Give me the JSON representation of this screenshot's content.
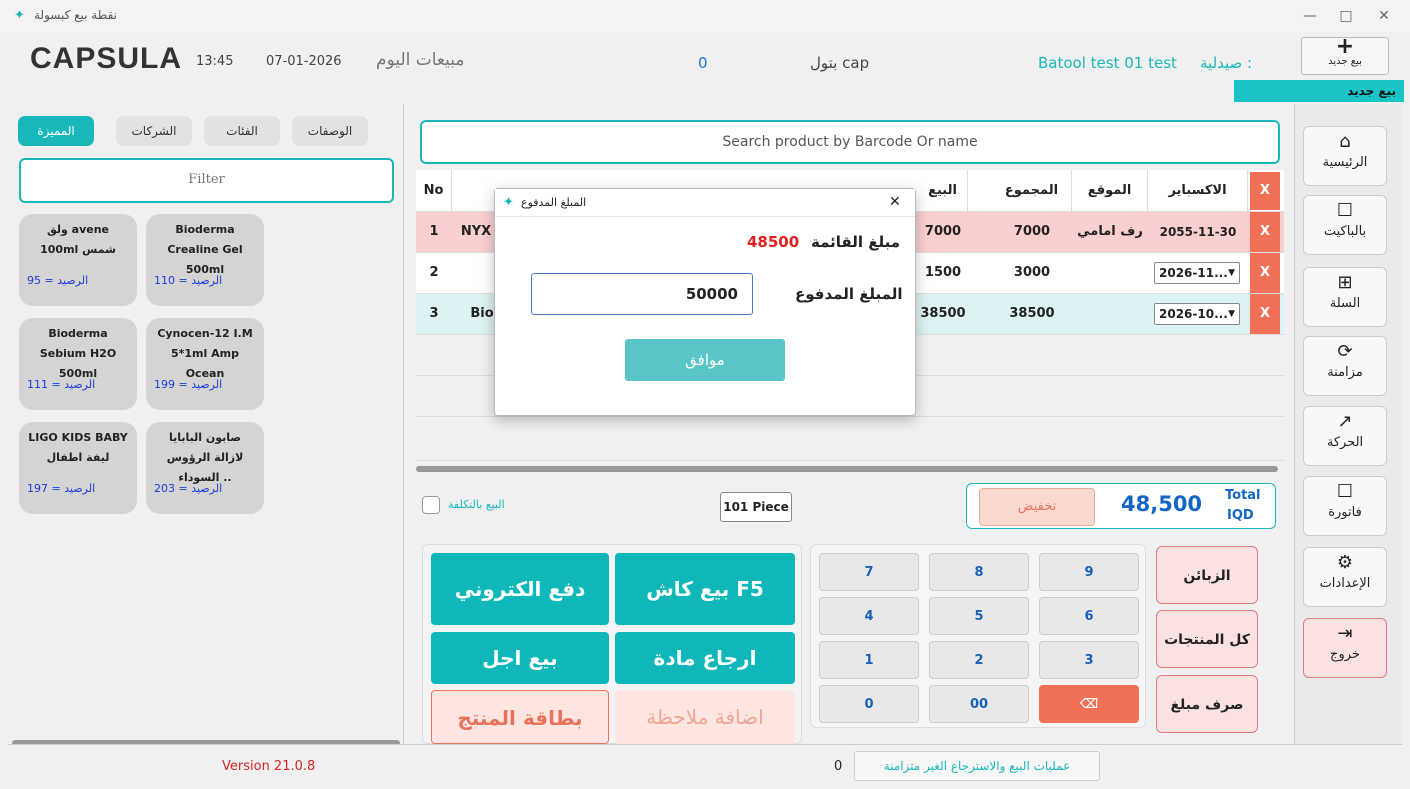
{
  "window": {
    "title": "نقطة بيع كبسولة",
    "min": "—",
    "max": "□",
    "close": "✕"
  },
  "header": {
    "logo": "CAPSULA",
    "time": "13:45",
    "date": "07-01-2026",
    "today_sales": "مبيعات اليوم",
    "today_value": "0",
    "user": "بتول cap",
    "pharmacy_label": "صيدلية :",
    "pharmacy_name": "Batool test 01 test",
    "new_sale": "بيع جديد",
    "new_sale_tag": "بيع جديد"
  },
  "left": {
    "tabs": [
      "الوصفات",
      "الفئات",
      "الشركات",
      "المميزة"
    ],
    "filter_placeholder": "Filter",
    "products": [
      {
        "name": "ولق avene 100ml شمس",
        "balance": "الرصيد = 95"
      },
      {
        "name": "Bioderma Crealine Gel 500ml",
        "balance": "الرصيد = 110"
      },
      {
        "name": "Bioderma Sebium H2O 500ml",
        "balance": "الرصيد = 111"
      },
      {
        "name": "Cynocen-12 I.M 5*1ml Amp Ocean",
        "balance": "الرصيد = 199"
      },
      {
        "name": "LIGO KIDS BABY ليفة اطفال",
        "balance": "الرصيد = 197"
      },
      {
        "name": "صابون البابايا لازالة الرؤوس السوداء ..",
        "balance": "الرصيد = 203"
      }
    ]
  },
  "main": {
    "search_placeholder": "Search product by Barcode Or  name",
    "columns": {
      "no": "No",
      "sale": "البيع",
      "total": "المجموع",
      "location": "الموقع",
      "expiry": "الاكسباير",
      "x": "X"
    },
    "rows": [
      {
        "no": "1",
        "name": "NYX",
        "sale": "7000",
        "total": "7000",
        "location": "رف امامي",
        "expiry": "2055-11-30",
        "x": "X"
      },
      {
        "no": "2",
        "name": "",
        "sale": "1500",
        "total": "3000",
        "location": "",
        "expiry": "2026-11...",
        "x": "X"
      },
      {
        "no": "3",
        "name": "Bio",
        "sale": "38500",
        "total": "38500",
        "location": "",
        "expiry": "2026-10...",
        "x": "X"
      }
    ],
    "sell_at_cost": "البيع بالتكلفة",
    "pieces": "101 Piece",
    "discount": "تخفيض",
    "total_value": "48,500",
    "total_label": "Total",
    "currency": "IQD",
    "actions": {
      "cash": "بيع كاش F5",
      "electronic": "دفع الكتروني",
      "return": "ارجاع مادة",
      "credit": "بيع اجل",
      "note": "اضافة ملاحظة",
      "card": "بطاقة المنتج"
    },
    "numpad": [
      "7",
      "8",
      "9",
      "4",
      "5",
      "6",
      "1",
      "2",
      "3",
      "0",
      "00",
      "⌫"
    ],
    "side": {
      "customers": "الزبائن",
      "all_products": "كل المنتجات",
      "spend": "صرف مبلغ"
    }
  },
  "nav": [
    {
      "icon": "home-icon",
      "glyph": "🏠",
      "label": "الرئيسية"
    },
    {
      "icon": "checkbox-icon",
      "glyph": "☐",
      "label": "بالباكيت"
    },
    {
      "icon": "cart-icon",
      "glyph": "🛒",
      "label": "السلة"
    },
    {
      "icon": "sync-icon",
      "glyph": "⟳",
      "label": "مزامنة"
    },
    {
      "icon": "chart-icon",
      "glyph": "📈",
      "label": "الحركة"
    },
    {
      "icon": "checkbox-icon",
      "glyph": "☐",
      "label": "فاتورة"
    },
    {
      "icon": "gear-icon",
      "glyph": "⚙",
      "label": "الإعدادات"
    },
    {
      "icon": "logout-icon",
      "glyph": "⇥",
      "label": "خروج"
    }
  ],
  "footer": {
    "version": "Version 21.0.8",
    "unsynced_count": "0",
    "unsynced_label": "عمليات البيع والاسترجاع الغير متزامنة"
  },
  "dialog": {
    "title": "المبلغ المدفوع",
    "invoice_label": "مبلغ القائمة",
    "invoice_value": "48500",
    "paid_label": "المبلغ المدفوع",
    "paid_value": "50000",
    "ok": "موافق",
    "close": "✕"
  },
  "colors": {
    "teal": "#19b7ba",
    "red": "#f07158",
    "pink": "#fbe2e2"
  }
}
